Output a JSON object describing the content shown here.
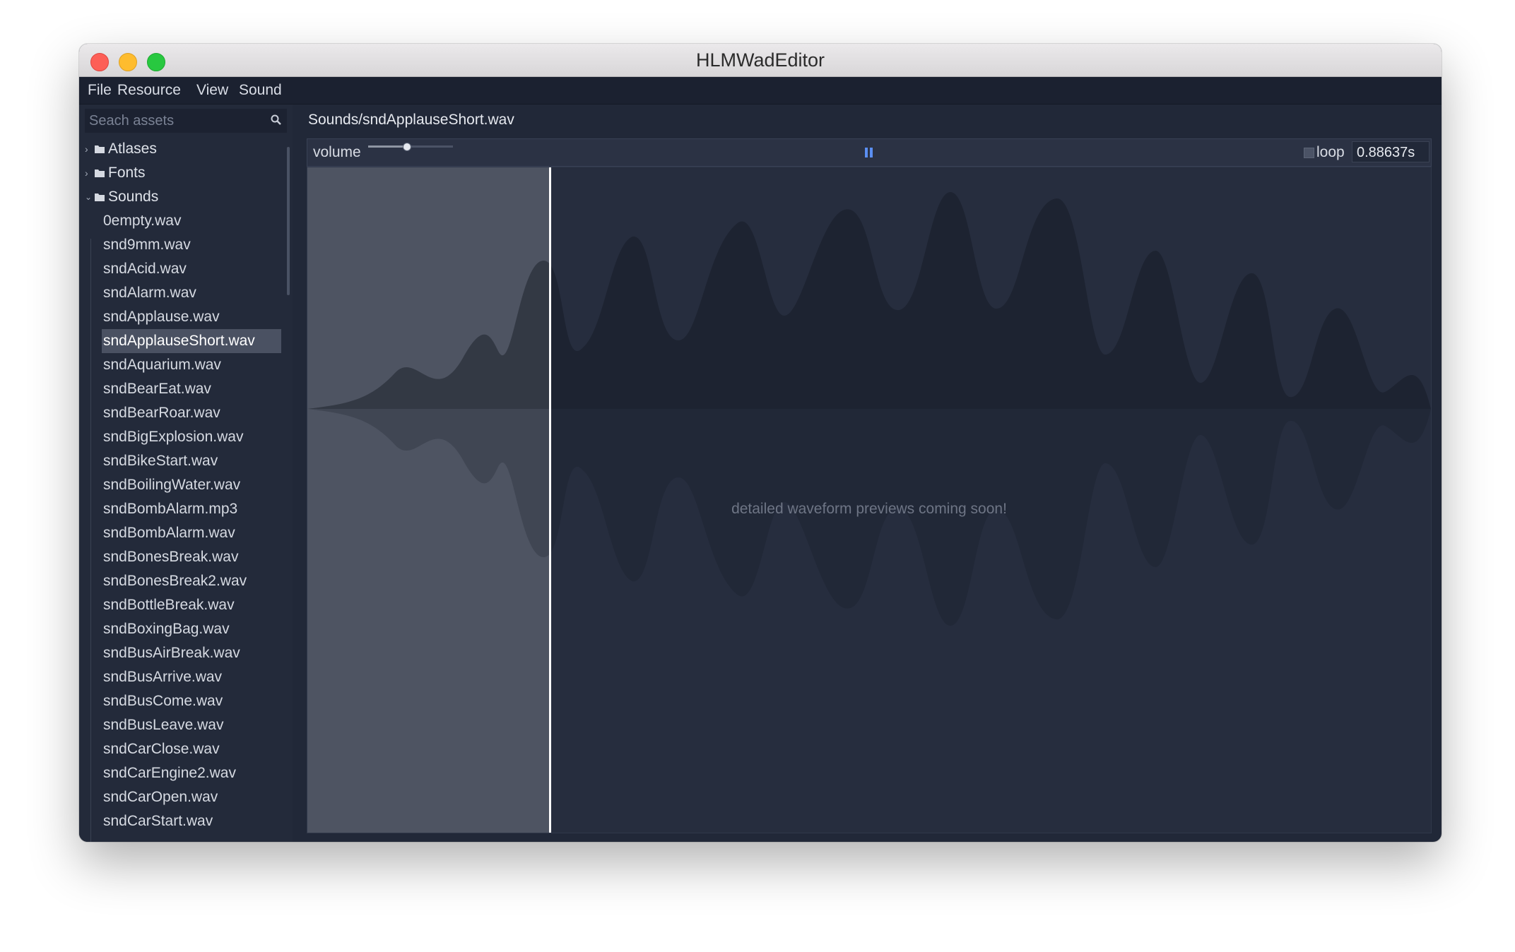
{
  "window": {
    "title": "HLMWadEditor"
  },
  "menu": {
    "items": [
      "File",
      "Resource",
      "View",
      "Sound"
    ]
  },
  "search": {
    "placeholder": "Seach assets",
    "value": ""
  },
  "tree": {
    "folders": [
      {
        "label": "Atlases",
        "expanded": false
      },
      {
        "label": "Fonts",
        "expanded": false
      },
      {
        "label": "Sounds",
        "expanded": true
      }
    ],
    "files": [
      "0empty.wav",
      "snd9mm.wav",
      "sndAcid.wav",
      "sndAlarm.wav",
      "sndApplause.wav",
      "sndApplauseShort.wav",
      "sndAquarium.wav",
      "sndBearEat.wav",
      "sndBearRoar.wav",
      "sndBigExplosion.wav",
      "sndBikeStart.wav",
      "sndBoilingWater.wav",
      "sndBombAlarm.mp3",
      "sndBombAlarm.wav",
      "sndBonesBreak.wav",
      "sndBonesBreak2.wav",
      "sndBottleBreak.wav",
      "sndBoxingBag.wav",
      "sndBusAirBreak.wav",
      "sndBusArrive.wav",
      "sndBusCome.wav",
      "sndBusLeave.wav",
      "sndCarClose.wav",
      "sndCarEngine2.wav",
      "sndCarOpen.wav",
      "sndCarStart.wav"
    ],
    "selected": "sndApplauseShort.wav"
  },
  "player": {
    "path": "Sounds/sndApplauseShort.wav",
    "volume_label": "volume",
    "volume": 0.45,
    "loop_label": "loop",
    "loop": false,
    "time": "0.88637s",
    "progress": 0.215,
    "message": "detailed waveform previews coming soon!",
    "icons": {
      "play_state": "pause-icon",
      "search": "search-icon",
      "folder": "folder-icon"
    },
    "colors": {
      "accent": "#5b8ff3",
      "wave_top": "#1c212d",
      "wave_bottom": "#20273a",
      "played": "#4e5462"
    }
  }
}
